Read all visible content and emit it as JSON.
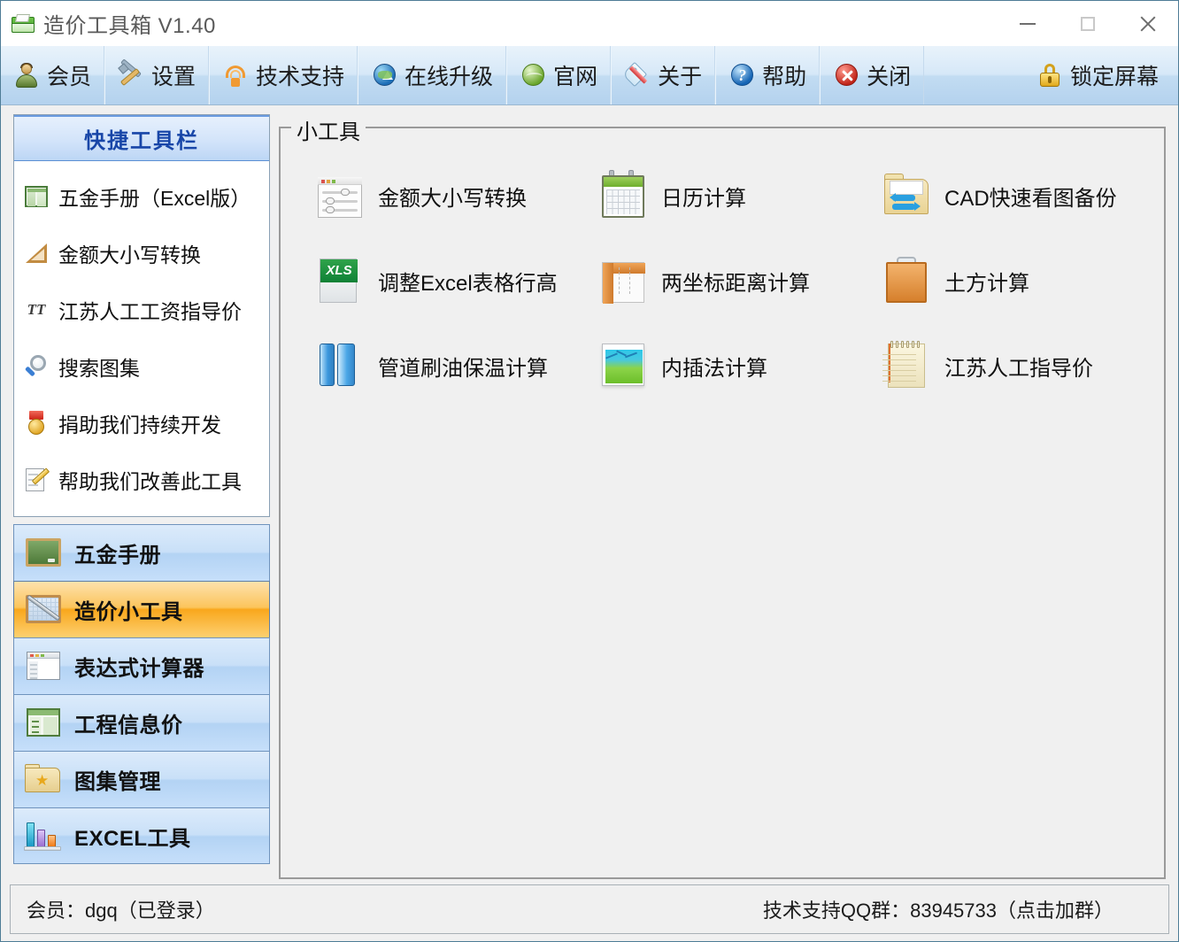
{
  "window": {
    "title": "造价工具箱 V1.40",
    "app_icon": "green-folder-icon",
    "controls": {
      "minimize": "minimize-icon",
      "maximize": "maximize-icon",
      "close": "close-icon"
    }
  },
  "toolbar": {
    "items": [
      {
        "label": "会员",
        "icon": "member-user-icon"
      },
      {
        "label": "设置",
        "icon": "settings-tools-icon"
      },
      {
        "label": "技术支持",
        "icon": "tech-support-icon"
      },
      {
        "label": "在线升级",
        "icon": "online-upgrade-globe-icon"
      },
      {
        "label": "官网",
        "icon": "website-globe-icon"
      },
      {
        "label": "关于",
        "icon": "about-tag-icon"
      },
      {
        "label": "帮助",
        "icon": "help-question-icon"
      },
      {
        "label": "关闭",
        "icon": "close-red-icon"
      }
    ],
    "lock_screen": {
      "label": "锁定屏幕",
      "icon": "lock-icon"
    }
  },
  "sidebar": {
    "quick_panel": {
      "title": "快捷工具栏",
      "items": [
        {
          "label": "五金手册（Excel版）",
          "icon": "book-icon"
        },
        {
          "label": "金额大小写转换",
          "icon": "ruler-triangle-icon"
        },
        {
          "label": "江苏人工工资指导价",
          "icon": "tt-font-icon"
        },
        {
          "label": "搜索图集",
          "icon": "magnifier-icon"
        },
        {
          "label": "捐助我们持续开发",
          "icon": "medal-icon"
        },
        {
          "label": "帮助我们改善此工具",
          "icon": "edit-pencil-icon"
        }
      ]
    },
    "categories": [
      {
        "label": "五金手册",
        "icon": "blackboard-icon",
        "active": false
      },
      {
        "label": "造价小工具",
        "icon": "drafting-icon",
        "active": true
      },
      {
        "label": "表达式计算器",
        "icon": "window-list-icon",
        "active": false
      },
      {
        "label": "工程信息价",
        "icon": "info-book-icon",
        "active": false
      },
      {
        "label": "图集管理",
        "icon": "star-folder-icon",
        "active": false
      },
      {
        "label": "EXCEL工具",
        "icon": "bar-chart-icon",
        "active": false
      }
    ]
  },
  "main": {
    "group_title": "小工具",
    "tools": [
      {
        "label": "金额大小写转换",
        "icon": "sliders-window-icon"
      },
      {
        "label": "日历计算",
        "icon": "calendar-icon"
      },
      {
        "label": "CAD快速看图备份",
        "icon": "cad-backup-folder-icon"
      },
      {
        "label": "调整Excel表格行高",
        "icon": "xls-file-icon"
      },
      {
        "label": "两坐标距离计算",
        "icon": "ruler-measure-icon"
      },
      {
        "label": "土方计算",
        "icon": "clipboard-icon"
      },
      {
        "label": "管道刷油保温计算",
        "icon": "pipes-icon"
      },
      {
        "label": "内插法计算",
        "icon": "chart-book-icon"
      },
      {
        "label": "江苏人工指导价",
        "icon": "notepad-icon"
      }
    ]
  },
  "statusbar": {
    "member": "会员：dgq（已登录）",
    "support": "技术支持QQ群：83945733（点击加群）"
  },
  "colors": {
    "accent_blue": "#1846a8",
    "active_orange": "#f9a71c",
    "toolbar_blue": "#c2dcf2",
    "panel_border": "#8aa0b4"
  }
}
